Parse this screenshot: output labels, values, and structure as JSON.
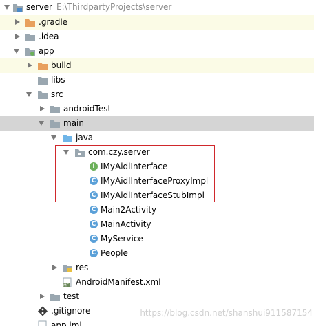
{
  "tree": {
    "root": {
      "label": "server",
      "path": "E:\\ThirdpartyProjects\\server"
    },
    "gradle": "gradle",
    "idea": ".idea",
    "app": "app",
    "build": "build",
    "libs": "libs",
    "src": "src",
    "android_test": "androidTest",
    "main": "main",
    "java": "java",
    "package": "com.czy.server",
    "classes": [
      {
        "name": "IMyAidlInterface",
        "kind": "interface",
        "letter": "I"
      },
      {
        "name": "IMyAidlInterfaceProxyImpl",
        "kind": "class",
        "letter": "C"
      },
      {
        "name": "IMyAidlInterfaceStubImpl",
        "kind": "class",
        "letter": "C"
      },
      {
        "name": "Main2Activity",
        "kind": "class",
        "letter": "C"
      },
      {
        "name": "MainActivity",
        "kind": "class",
        "letter": "C"
      },
      {
        "name": "MyService",
        "kind": "class",
        "letter": "C"
      },
      {
        "name": "People",
        "kind": "class",
        "letter": "C"
      }
    ],
    "res": "res",
    "manifest": "AndroidManifest.xml",
    "manifest_badge": "MF",
    "test": "test",
    "gitignore": ".gitignore",
    "app_iml": "app.iml"
  },
  "watermark": "https://blog.csdn.net/shanshui911587154",
  "colors": {
    "selected_row": "#d5d5d5",
    "excluded_row": "#fbfbe6",
    "folder": "#9aa7b0",
    "excluded_folder": "#e8a05c",
    "source_folder": "#6fb5e8",
    "class_icon": "#5aa0d8",
    "interface_icon": "#6cb05a",
    "highlight_box": "#d0282c"
  }
}
